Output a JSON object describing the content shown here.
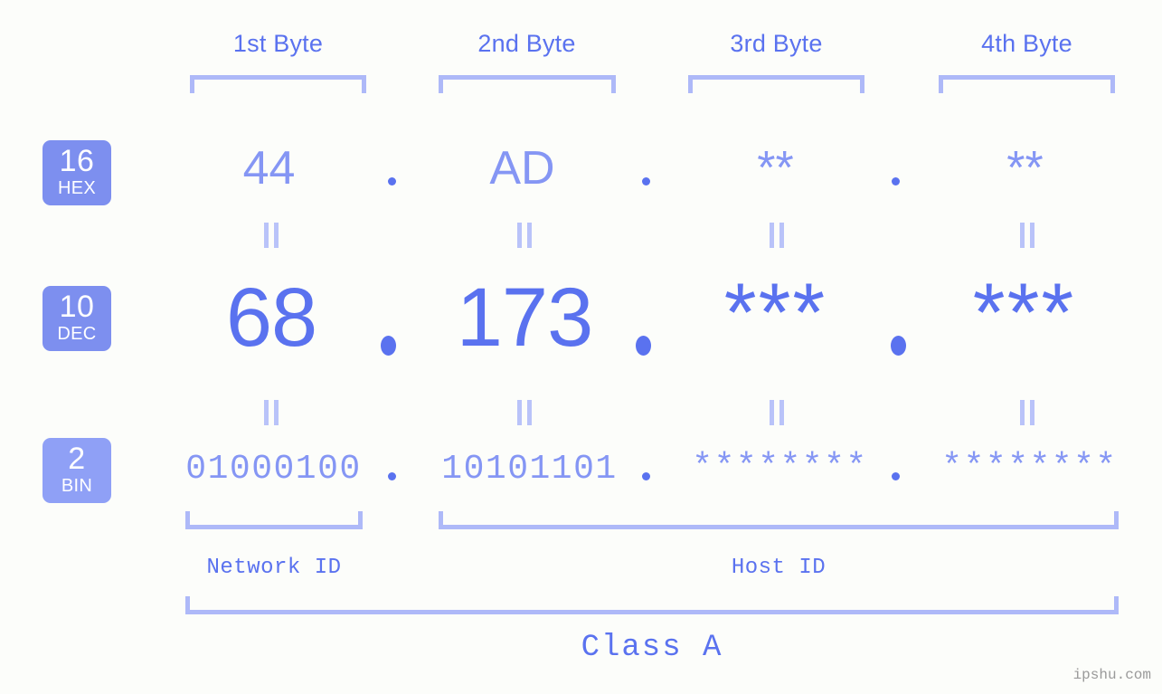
{
  "meta": {
    "background_color": "#fcfdfa",
    "accent_color": "#5a72ef",
    "accent_light_color": "#8596f4",
    "bracket_color": "#aeb9f8",
    "badge_color": "#7d8fef",
    "badge_light_color": "#8fa0f6",
    "watermark_color": "#9a9a9a"
  },
  "watermark": "ipshu.com",
  "byte_headers": [
    {
      "label": "1st Byte"
    },
    {
      "label": "2nd Byte"
    },
    {
      "label": "3rd Byte"
    },
    {
      "label": "4th Byte"
    }
  ],
  "rows": [
    {
      "id": "hex",
      "badge_number": "16",
      "badge_radix": "HEX",
      "values": [
        "44",
        "AD",
        "**",
        "**"
      ],
      "separator": "."
    },
    {
      "id": "dec",
      "badge_number": "10",
      "badge_radix": "DEC",
      "values": [
        "68",
        "173",
        "***",
        "***"
      ],
      "separator": "."
    },
    {
      "id": "bin",
      "badge_number": "2",
      "badge_radix": "BIN",
      "values": [
        "01000100",
        "10101101",
        "********",
        "********"
      ],
      "separator": "."
    }
  ],
  "equivalence_marks": {
    "glyph": "||",
    "count_per_gap": 4
  },
  "id_sections": [
    {
      "label": "Network ID"
    },
    {
      "label": "Host ID"
    }
  ],
  "class_section": {
    "label": "Class A"
  }
}
